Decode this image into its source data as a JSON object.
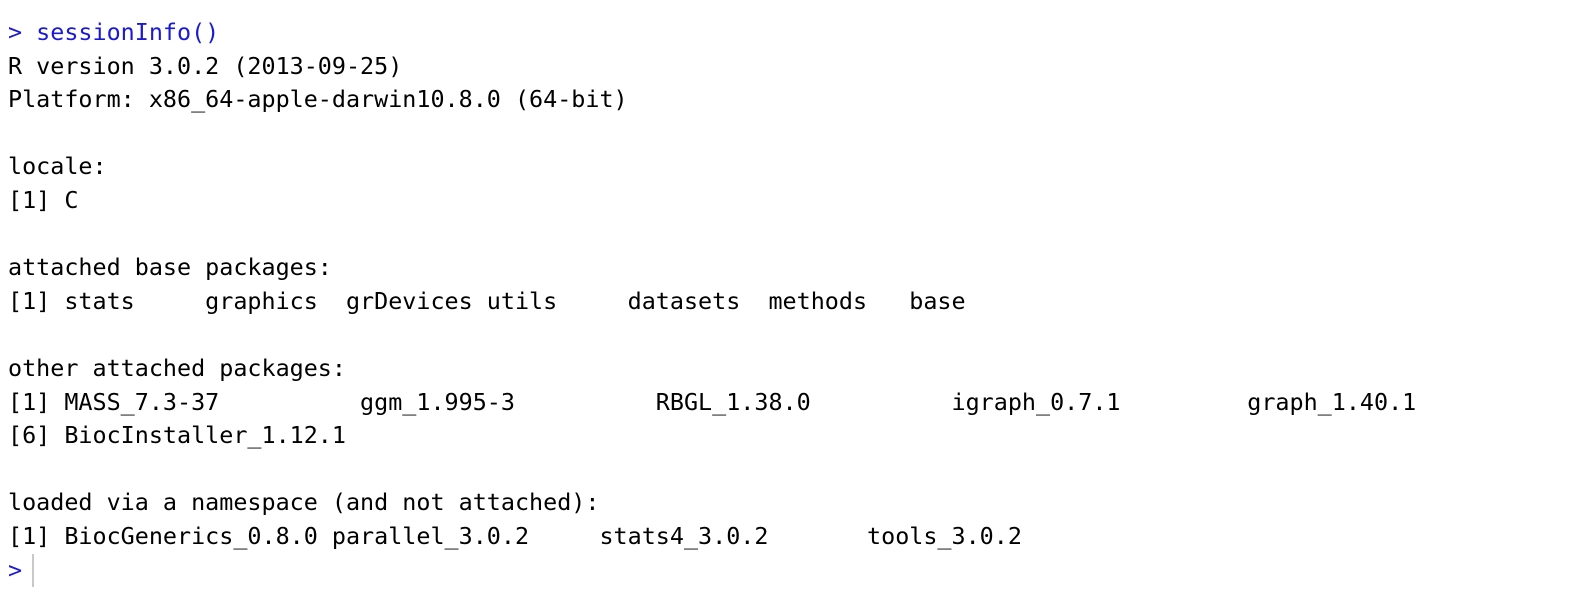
{
  "console": {
    "prompt": "> ",
    "command": "sessionInfo()",
    "r_version": "R version 3.0.2 (2013-09-25)",
    "platform": "Platform: x86_64-apple-darwin10.8.0 (64-bit)",
    "locale_header": "locale:",
    "locale_value": "[1] C",
    "base_header": "attached base packages:",
    "base_line": "[1] stats     graphics  grDevices utils     datasets  methods   base",
    "other_header": "other attached packages:",
    "other_line_1": "[1] MASS_7.3-37          ggm_1.995-3          RBGL_1.38.0          igraph_0.7.1         graph_1.40.1",
    "other_line_2": "[6] BiocInstaller_1.12.1",
    "namespace_header": "loaded via a namespace (and not attached):",
    "namespace_line": "[1] BiocGenerics_0.8.0 parallel_3.0.2     stats4_3.0.2       tools_3.0.2",
    "final_prompt": ">"
  },
  "colors": {
    "command": "#1a1ad6",
    "output": "#000000",
    "cursor": "#c8c8c8"
  }
}
